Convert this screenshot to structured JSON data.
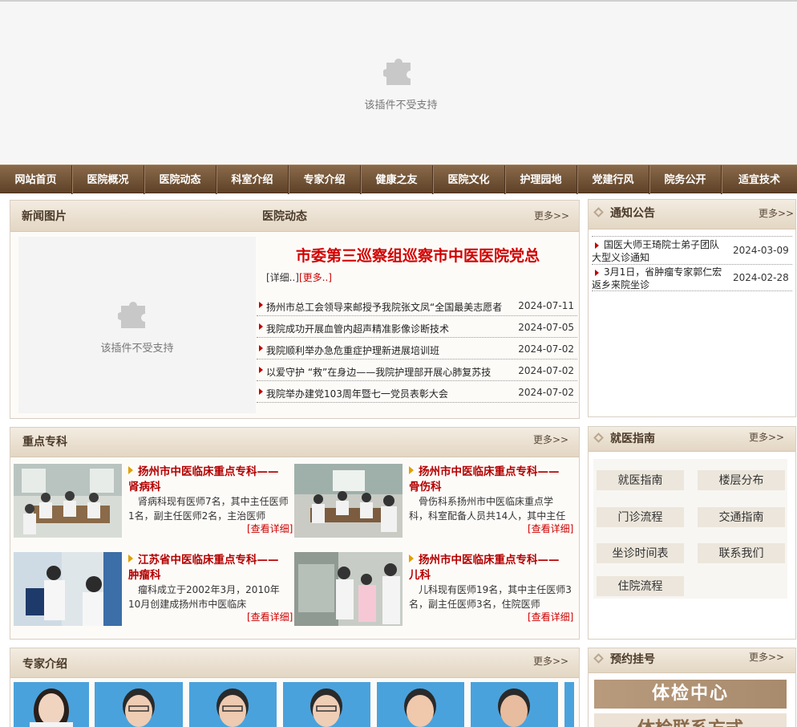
{
  "plugin_notice": "该插件不受支持",
  "nav": [
    "网站首页",
    "医院概况",
    "医院动态",
    "科室介绍",
    "专家介绍",
    "健康之友",
    "医院文化",
    "护理园地",
    "党建行风",
    "院务公开",
    "适宜技术"
  ],
  "more_label": "更多>>",
  "news_photos": {
    "title": "新闻图片"
  },
  "hospital_news": {
    "title": "医院动态",
    "headline": "市委第三巡察组巡察市中医医院党总",
    "detail_label": "[详细..]",
    "more_inline": "[更多..]",
    "items": [
      {
        "title": "扬州市总工会领导来邮授予我院张文凤“全国最美志愿者",
        "date": "2024-07-11"
      },
      {
        "title": "我院成功开展血管内超声精准影像诊断技术",
        "date": "2024-07-05"
      },
      {
        "title": "我院顺利举办急危重症护理新进展培训班",
        "date": "2024-07-02"
      },
      {
        "title": "以爱守护 “救”在身边——我院护理部开展心肺复苏技",
        "date": "2024-07-02"
      },
      {
        "title": "我院举办建党103周年暨七一党员表彰大会",
        "date": "2024-07-02"
      }
    ]
  },
  "notices": {
    "title": "通知公告",
    "items": [
      {
        "title": "国医大师王琦院士弟子团队大型义诊通知",
        "date": "2024-03-09"
      },
      {
        "title": "3月1日，省肿瘤专家郭仁宏返乡来院坐诊",
        "date": "2024-02-28"
      }
    ]
  },
  "key_depts": {
    "title": "重点专科",
    "detail_label": "[查看详细]",
    "items": [
      {
        "title": "扬州市中医临床重点专科——肾病科",
        "desc": "肾病科现有医师7名，其中主任医师1名，副主任医师2名，主治医师"
      },
      {
        "title": "扬州市中医临床重点专科——骨伤科",
        "desc": "骨伤科系扬州市中医临床重点学科，科室配备人员共14人，其中主任"
      },
      {
        "title": "江苏省中医临床重点专科——肿瘤科",
        "desc": "瘤科成立于2002年3月，2010年10月创建成扬州市中医临床"
      },
      {
        "title": "扬州市中医临床重点专科——儿科",
        "desc": "儿科现有医师19名，其中主任医师3名，副主任医师3名，住院医师"
      }
    ]
  },
  "guide": {
    "title": "就医指南",
    "buttons": [
      "就医指南",
      "楼层分布",
      "门诊流程",
      "交通指南",
      "坐诊时间表",
      "联系我们",
      "住院流程"
    ]
  },
  "experts": {
    "title": "专家介绍"
  },
  "booking": {
    "title": "预约挂号",
    "banners": [
      "体检中心",
      "体检联系方式"
    ]
  },
  "colors": {
    "nav_bg": "#6e5035",
    "headline": "#d10000",
    "accent_red": "#c00000",
    "expert_bg": "#4aa2dc"
  }
}
